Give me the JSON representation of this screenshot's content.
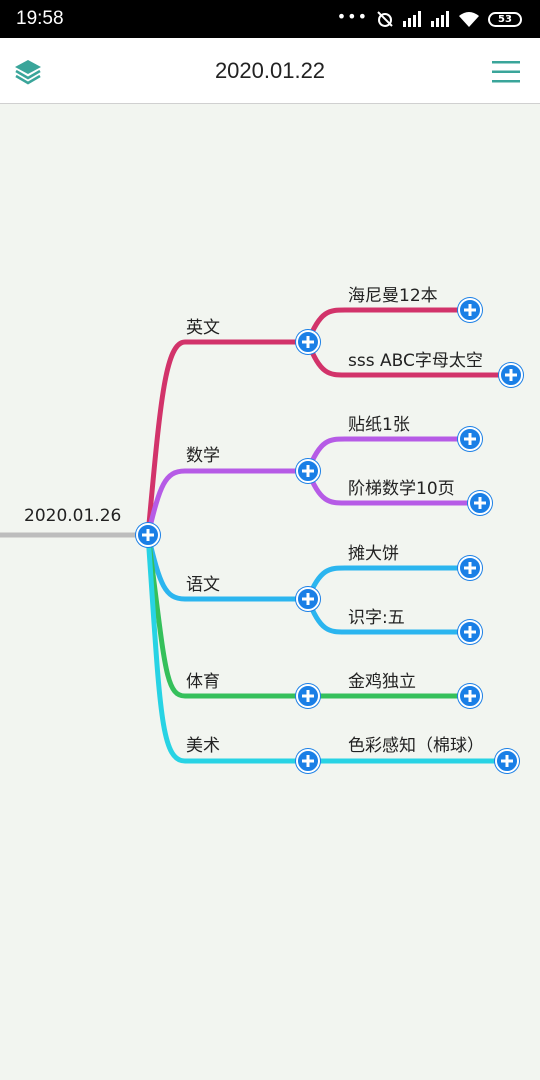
{
  "status": {
    "time": "19:58",
    "battery": "53"
  },
  "header": {
    "title": "2020.01.22"
  },
  "mindmap": {
    "root": {
      "label": "2020.01.26"
    },
    "branches": [
      {
        "label": "英文",
        "color": "#d2336a",
        "children": [
          "海尼曼12本",
          "sss ABC字母太空"
        ]
      },
      {
        "label": "数学",
        "color": "#b65be6",
        "children": [
          "贴纸1张",
          "阶梯数学10页"
        ]
      },
      {
        "label": "语文",
        "color": "#2bb5ef",
        "children": [
          "摊大饼",
          "识字:五"
        ]
      },
      {
        "label": "体育",
        "color": "#35c05b",
        "children": [
          "金鸡独立"
        ]
      },
      {
        "label": "美术",
        "color": "#28d3e4",
        "children": [
          "色彩感知（棉球）"
        ]
      }
    ]
  },
  "icons": {
    "layers": "layers-icon",
    "menu": "menu-icon",
    "add": "plus-icon"
  }
}
